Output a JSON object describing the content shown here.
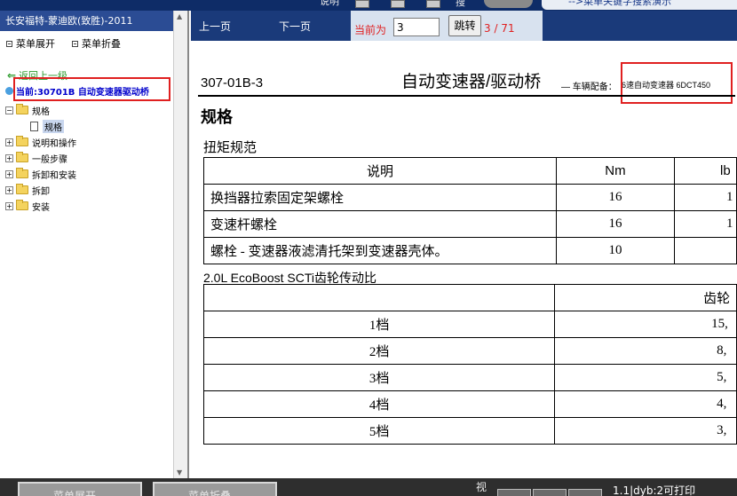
{
  "topbar": {
    "partial_label_1": "说明",
    "partial_label_2": "搜",
    "partial_link": "-->菜单关键字搜索演示"
  },
  "left_panel": {
    "title": "长安福特-蒙迪欧(致胜)-2011",
    "expand_label": "菜单展开",
    "collapse_label": "菜单折叠",
    "back_label": "返回上一级",
    "current_label": "当前:30701B 自动变速器驱动桥",
    "tree": [
      {
        "label": "规格",
        "children": [
          {
            "label": "规格"
          }
        ]
      },
      {
        "label": "说明和操作"
      },
      {
        "label": "一般步骤"
      },
      {
        "label": "拆卸和安装"
      },
      {
        "label": "拆卸"
      },
      {
        "label": "安装"
      }
    ]
  },
  "toolbar": {
    "prev_label": "上一页",
    "next_label": "下一页",
    "current_label": "当前为",
    "page_input": "3",
    "jump_label": "跳转",
    "page_count": "3 / 71"
  },
  "document": {
    "code": "307-01B-3",
    "title": "自动变速器/驱动桥",
    "subtitle": "— 车辆配备：",
    "spec": "6速自动变速器 6DCT450",
    "section_title": "规格",
    "torque_title": "扭矩规范",
    "torque_table": {
      "headers": [
        "说明",
        "Nm",
        "lb"
      ],
      "rows": [
        [
          "换挡器拉索固定架螺栓",
          "16",
          "1"
        ],
        [
          "变速杆螺栓",
          "16",
          "1"
        ],
        [
          "螺栓 - 变速器液滤清托架到变速器壳体。",
          "10",
          ""
        ]
      ]
    },
    "gear_title": "2.0L EcoBoost SCTi齿轮传动比",
    "gear_table": {
      "header": "齿轮",
      "rows": [
        [
          "1档",
          "15,"
        ],
        [
          "2档",
          "8,"
        ],
        [
          "3档",
          "5,"
        ],
        [
          "4档",
          "4,"
        ],
        [
          "5档",
          "3,"
        ]
      ]
    }
  },
  "statusbar": {
    "btn1_label": "菜单展开",
    "btn2_label": "菜单折叠",
    "view_label": "视",
    "info": "1.1|dyb:2可打印"
  }
}
